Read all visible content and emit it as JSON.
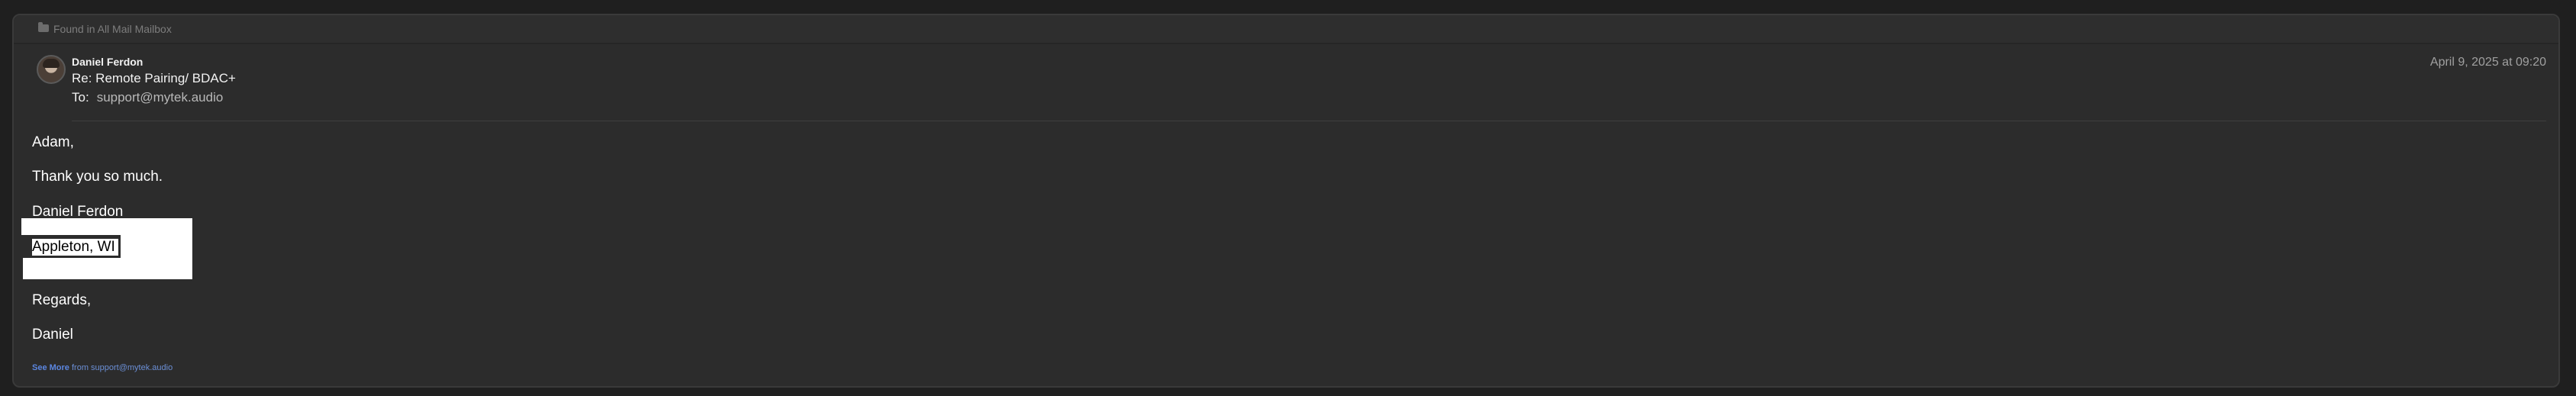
{
  "found_bar": {
    "icon": "folder-icon",
    "text": "Found in All Mail Mailbox"
  },
  "header": {
    "sender_name": "Daniel Ferdon",
    "subject": "Re: Remote Pairing/ BDAC+",
    "to_label": "To:",
    "to_address": "support@mytek.audio",
    "date": "April 9, 2025 at 09:20"
  },
  "body": {
    "greeting": "Adam,",
    "thanks": "Thank you so much.",
    "signature_name": "Daniel Ferdon",
    "signature_city": "Appleton, WI",
    "closing": "Regards,",
    "sign_off": "Daniel"
  },
  "footer": {
    "see_more": "See More",
    "see_more_from": "from support@mytek.audio"
  },
  "colors": {
    "background": "#1f1f1f",
    "card": "#2c2c2c",
    "text_primary": "#ffffff",
    "text_muted": "#a0a0a0",
    "link": "#5b86e0"
  }
}
